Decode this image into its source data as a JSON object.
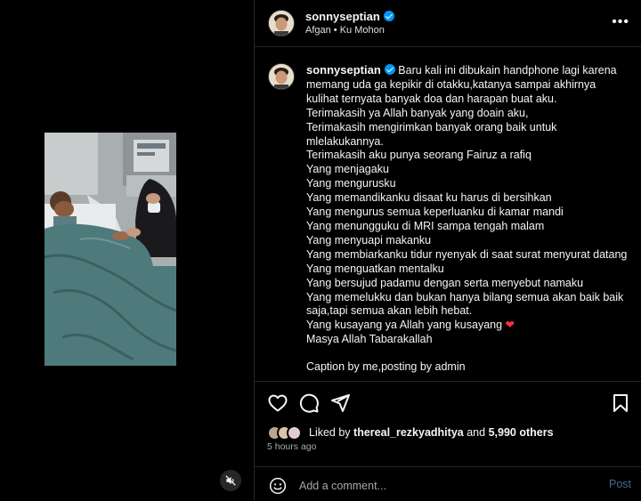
{
  "header": {
    "username": "sonnyseptian",
    "audio": "Afgan • Ku Mohon"
  },
  "caption": {
    "username": "sonnyseptian",
    "first_line": "Baru kali ini dibukain handphone lagi karena",
    "lines": [
      "memang uda ga kepikir di otakku,katanya sampai akhirnya",
      "kulihat ternyata banyak doa dan harapan buat aku.",
      "Terimakasih ya Allah banyak yang doain aku,",
      "Terimakasih mengirimkan banyak orang baik untuk",
      "mlelakukannya.",
      "Terimakasih aku punya seorang Fairuz a rafiq",
      "Yang menjagaku",
      "Yang mengurusku",
      "Yang memandikanku disaat ku harus di bersihkan",
      "Yang mengurus semua keperluanku di kamar mandi",
      "Yang menungguku di MRI sampa tengah malam",
      "Yang menyuapi makanku",
      "Yang membiarkanku tidur nyenyak di saat surat menyurat datang",
      "Yang menguatkan mentalku",
      "Yang bersujud padamu dengan serta menyebut namaku",
      "Yang memelukku dan bukan hanya bilang semua akan baik baik",
      "saja,tapi semua akan lebih hebat."
    ],
    "last_line_text": "Yang kusayang ya Allah yang kusayang",
    "heart": "❤",
    "closing": "Masya Allah Tabarakallah",
    "credit": "Caption by me,posting by admin"
  },
  "likes": {
    "prefix": "Liked by",
    "user": "thereal_rezkyadhitya",
    "and": "and",
    "others": "5,990 others"
  },
  "time": "5 hours ago",
  "comment": {
    "placeholder": "Add a comment...",
    "post_label": "Post"
  },
  "colors": {
    "background": "#000000",
    "verified": "#0095f6",
    "heart": "#ff3040",
    "muted_text": "#a8a8a8",
    "post_disabled": "#4a6a8a"
  }
}
